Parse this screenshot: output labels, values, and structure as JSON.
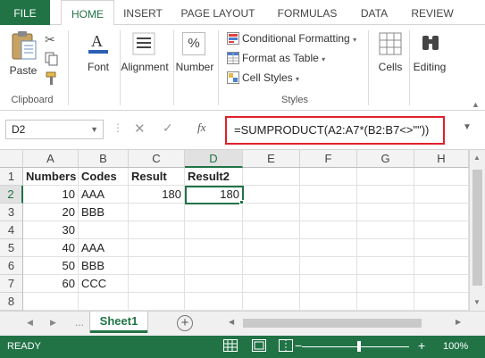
{
  "ribbon_tabs": [
    "FILE",
    "HOME",
    "INSERT",
    "PAGE LAYOUT",
    "FORMULAS",
    "DATA",
    "REVIEW"
  ],
  "clipboard": {
    "paste": "Paste",
    "group_label": "Clipboard"
  },
  "font": {
    "label": "Font"
  },
  "alignment": {
    "label": "Alignment"
  },
  "number": {
    "label": "Number",
    "icon_text": "%"
  },
  "styles": {
    "conditional_formatting": "Conditional Formatting",
    "format_as_table": "Format as Table",
    "cell_styles": "Cell Styles",
    "group_label": "Styles"
  },
  "cells": {
    "label": "Cells"
  },
  "editing": {
    "label": "Editing"
  },
  "formula_bar": {
    "name_box": "D2",
    "fx": "fx",
    "formula": "=SUMPRODUCT(A2:A7*(B2:B7<>\"\"))"
  },
  "columns": [
    "A",
    "B",
    "C",
    "D",
    "E",
    "F",
    "G",
    "H"
  ],
  "rows": [
    "1",
    "2",
    "3",
    "4",
    "5",
    "6",
    "7",
    "8"
  ],
  "cells_data": [
    [
      "Numbers",
      "Codes",
      "Result",
      "Result2",
      "",
      "",
      "",
      ""
    ],
    [
      "10",
      "AAA",
      "180",
      "180",
      "",
      "",
      "",
      ""
    ],
    [
      "20",
      "BBB",
      "",
      "",
      "",
      "",
      "",
      ""
    ],
    [
      "30",
      "",
      "",
      "",
      "",
      "",
      "",
      ""
    ],
    [
      "40",
      "AAA",
      "",
      "",
      "",
      "",
      "",
      ""
    ],
    [
      "50",
      "BBB",
      "",
      "",
      "",
      "",
      "",
      ""
    ],
    [
      "60",
      "CCC",
      "",
      "",
      "",
      "",
      "",
      ""
    ],
    [
      "",
      "",
      "",
      "",
      "",
      "",
      "",
      ""
    ]
  ],
  "sheets": {
    "active": "Sheet1",
    "nav_dots": "..."
  },
  "status": {
    "ready": "READY",
    "zoom": "100%"
  },
  "colors": {
    "excel_green": "#217346",
    "highlight_red": "#e0202a"
  }
}
